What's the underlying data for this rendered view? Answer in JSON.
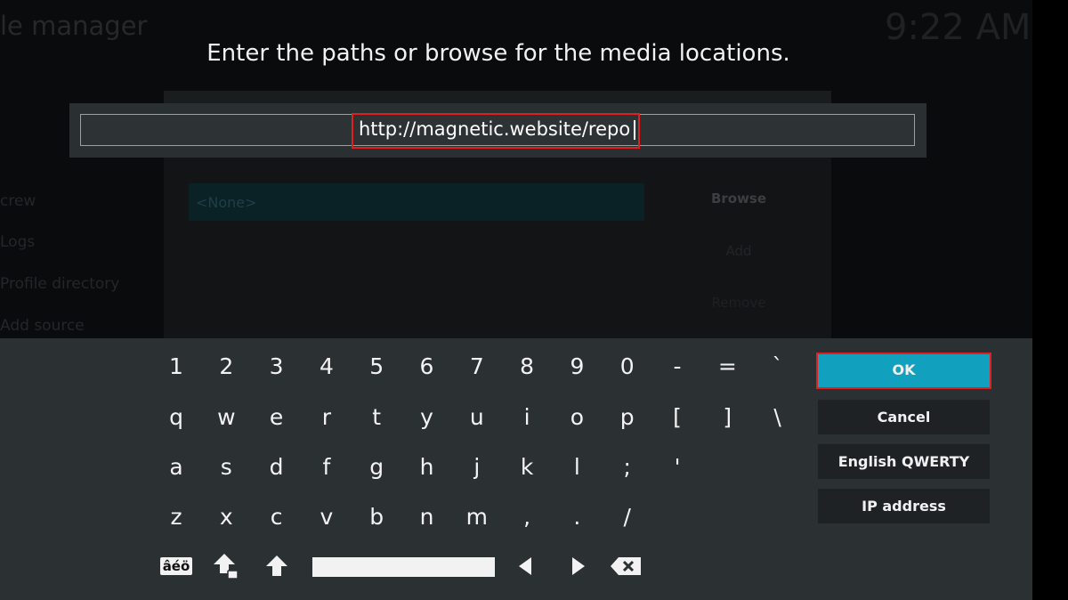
{
  "background": {
    "title": "le manager",
    "clock": "9:22 AM",
    "sidebar_items": [
      "crew",
      "Logs",
      "Profile directory",
      "Add source"
    ],
    "source_none": "<None>",
    "buttons": [
      "Browse",
      "Add",
      "Remove"
    ]
  },
  "dialog": {
    "heading": "Enter the paths or browse for the media locations.",
    "input_value": "http://magnetic.website/repo"
  },
  "keyboard": {
    "rows": [
      [
        "1",
        "2",
        "3",
        "4",
        "5",
        "6",
        "7",
        "8",
        "9",
        "0",
        "-",
        "=",
        "`"
      ],
      [
        "q",
        "w",
        "e",
        "r",
        "t",
        "y",
        "u",
        "i",
        "o",
        "p",
        "[",
        "]",
        "\\"
      ],
      [
        "a",
        "s",
        "d",
        "f",
        "g",
        "h",
        "j",
        "k",
        "l",
        ";",
        "'"
      ],
      [
        "z",
        "x",
        "c",
        "v",
        "b",
        "n",
        "m",
        ",",
        ".",
        "/"
      ]
    ],
    "symbols_label": "âéö",
    "icons": [
      "shift-lock-icon",
      "shift-icon",
      "arrow-left-icon",
      "arrow-right-icon",
      "backspace-icon"
    ]
  },
  "side_buttons": {
    "ok": "OK",
    "cancel": "Cancel",
    "layout": "English QWERTY",
    "ip": "IP address"
  },
  "colors": {
    "ok_bg": "#12a0bf",
    "highlight_border": "#e02020",
    "keyboard_bg": "#2b3033"
  }
}
